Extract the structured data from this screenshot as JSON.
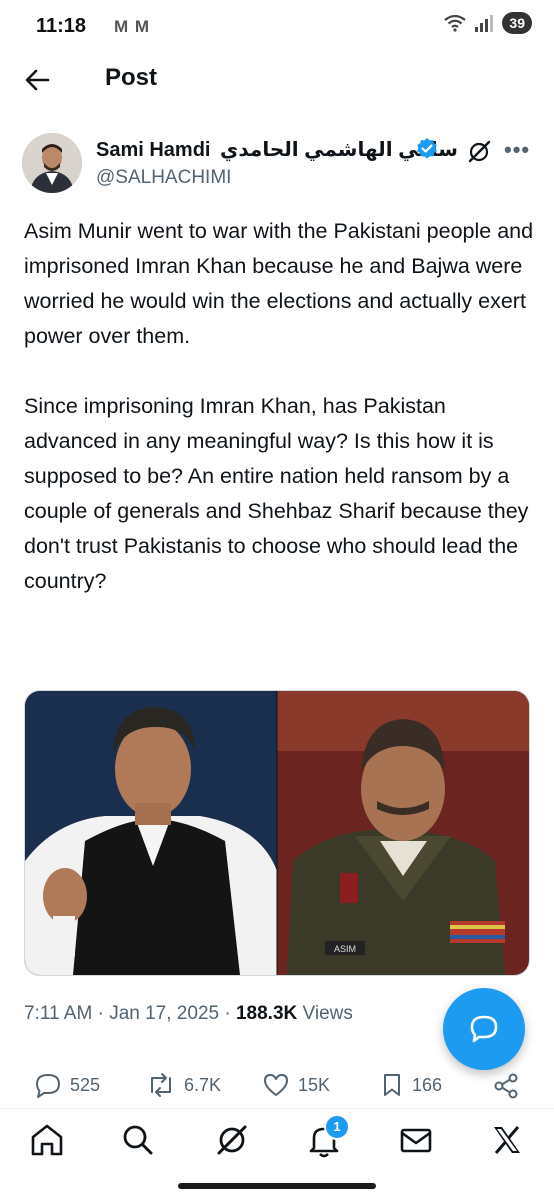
{
  "status_bar": {
    "time": "11:18",
    "notif_icons": "M M",
    "battery": "39"
  },
  "header": {
    "title": "Post"
  },
  "author": {
    "name": "Sami Hamdi",
    "arabic_name": "سامي الهاشمي الحامدي",
    "handle": "@SALHACHIMI"
  },
  "tweet": {
    "text": "Asim Munir went to war with the Pakistani people and imprisoned Imran Khan because he and Bajwa were worried he would win the elections and actually exert power over them.\n\nSince imprisoning Imran Khan, has Pakistan advanced in any meaningful way? Is this how it is supposed to be? An entire nation held ransom by a couple of generals and Shehbaz Sharif because they don't trust Pakistanis to choose who should lead the country?"
  },
  "meta": {
    "time": "7:11 AM",
    "date": "Jan 17, 2025",
    "views_count": "188.3K",
    "views_label": "Views"
  },
  "actions": {
    "replies": "525",
    "reposts": "6.7K",
    "likes": "15K",
    "bookmarks": "166"
  },
  "nav": {
    "notifications_badge": "1"
  },
  "colors": {
    "accent": "#1d9bf0",
    "text": "#0f1419",
    "muted": "#536471"
  },
  "media": {
    "name_tape": "ASIM"
  },
  "icons": {
    "back": "arrow-left-icon",
    "verified": "verified-badge-icon",
    "grok": "grok-icon",
    "more": "more-icon",
    "reply": "reply-icon",
    "repost": "repost-icon",
    "like": "heart-icon",
    "bookmark": "bookmark-icon",
    "share": "share-icon",
    "compose": "compose-icon",
    "home": "home-icon",
    "search": "search-icon",
    "notifications": "bell-icon",
    "messages": "mail-icon",
    "x": "x-logo-icon"
  }
}
